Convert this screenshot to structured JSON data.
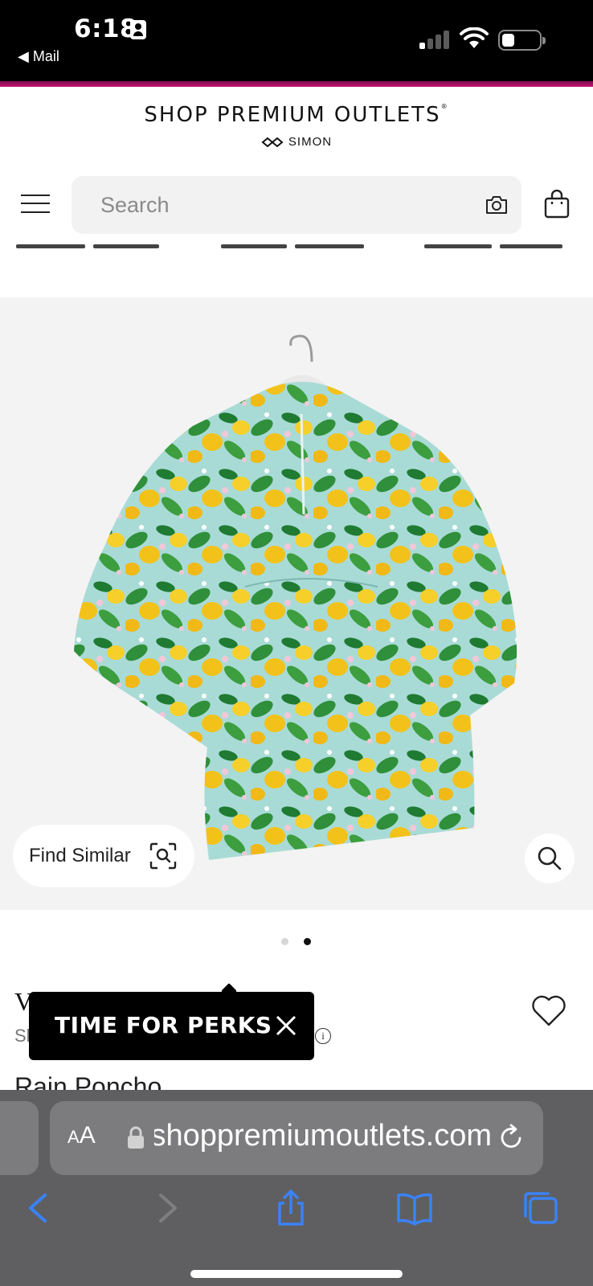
{
  "status_bar": {
    "time": "6:18",
    "back_app": "◀ Mail"
  },
  "header": {
    "brand": "SHOP PREMIUM OUTLETS",
    "brand_mark": "®",
    "sub_brand": "SIMON",
    "search_placeholder": "Search"
  },
  "product": {
    "find_similar_label": "Find Similar",
    "carousel_count": 2,
    "carousel_active": 2,
    "brand_name": "V",
    "shop_label": "Sh",
    "title": "Rain Poncho",
    "info_glyph": "i"
  },
  "popup": {
    "text": "TIME FOR PERKS"
  },
  "safari": {
    "aa_small": "A",
    "aa_large": "A",
    "url": "shoppremiumoutlets.com"
  },
  "colors": {
    "accent_strip": "#c4126f",
    "safari_icons": "#3a82f7"
  }
}
